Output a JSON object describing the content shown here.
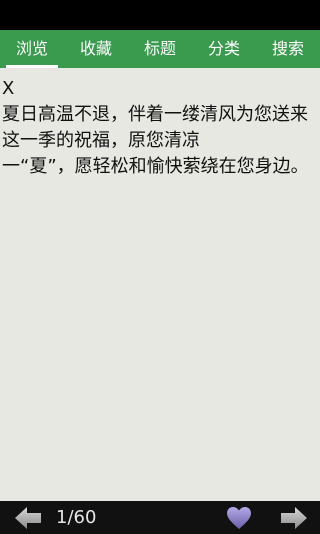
{
  "tabs": [
    {
      "label": "浏览",
      "active": true
    },
    {
      "label": "收藏",
      "active": false
    },
    {
      "label": "标题",
      "active": false
    },
    {
      "label": "分类",
      "active": false
    },
    {
      "label": "搜索",
      "active": false
    }
  ],
  "content": {
    "title": "X",
    "body": "夏日高温不退，伴着一缕清风为您送来这一季的祝福，原您清凉\n一“夏”，愿轻松和愉快萦绕在您身边。"
  },
  "footer": {
    "page_indicator": "1/60",
    "prev_icon": "left-arrow",
    "next_icon": "right-arrow",
    "favorite_icon": "heart"
  },
  "colors": {
    "tabbar": "#3a9a4e",
    "background": "#e8e8e2",
    "bottombar": "#111111",
    "heart": "#8b7fc4"
  }
}
